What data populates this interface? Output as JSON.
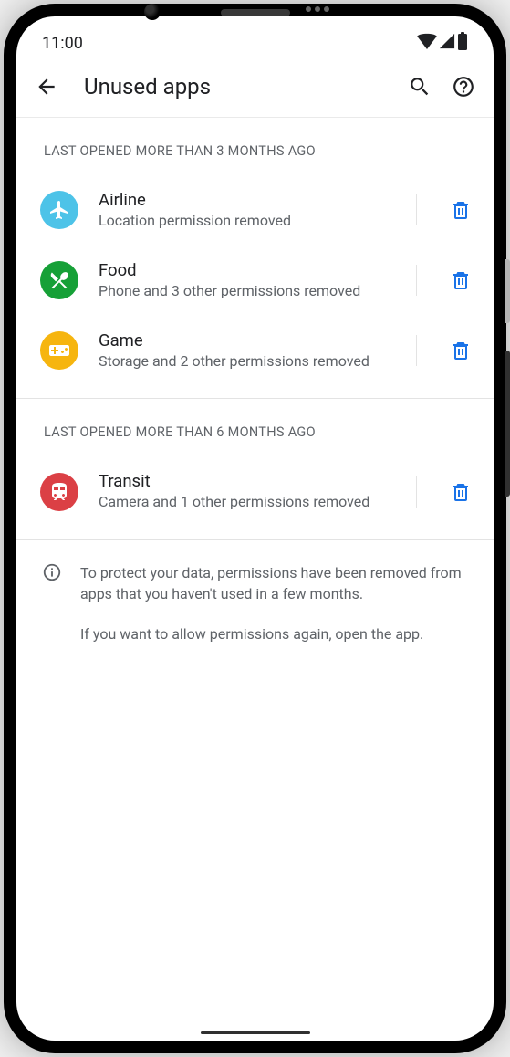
{
  "status_bar": {
    "time": "11:00"
  },
  "header": {
    "title": "Unused apps"
  },
  "sections": [
    {
      "header": "LAST OPENED MORE THAN 3 MONTHS AGO",
      "apps": [
        {
          "name": "Airline",
          "sub": "Location permission removed"
        },
        {
          "name": "Food",
          "sub": "Phone and 3 other permissions removed"
        },
        {
          "name": "Game",
          "sub": "Storage and 2 other permissions removed"
        }
      ]
    },
    {
      "header": "LAST OPENED MORE THAN 6 MONTHS AGO",
      "apps": [
        {
          "name": "Transit",
          "sub": "Camera and 1 other permissions removed"
        }
      ]
    }
  ],
  "info": {
    "p1": "To protect your data, permissions have been removed from  apps that you haven't used in a few months.",
    "p2": "If you want to allow permissions again, open the app."
  },
  "colors": {
    "airline": "#4dc3e8",
    "food": "#16a037",
    "game": "#f6b50f",
    "transit": "#db4045",
    "accent": "#1a73e8"
  }
}
